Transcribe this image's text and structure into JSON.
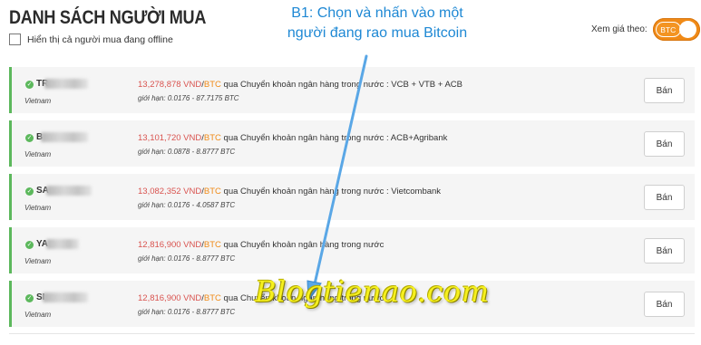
{
  "header": {
    "title": "DANH SÁCH NGƯỜI MUA",
    "offline_label": "Hiển thị cả người mua đang offline",
    "price_label": "Xem giá theo:",
    "currency_toggle": "BTC"
  },
  "instruction": {
    "line1": "B1: Chọn và nhấn vào một",
    "line2": "người đang rao mua Bitcoin"
  },
  "listings": [
    {
      "name": "TR",
      "country": "Vietnam",
      "price": "13,278,878 VND",
      "currency": "BTC",
      "method": " qua Chuyển khoản ngân hàng trong nước : VCB + VTB + ACB",
      "limit": "giới hạn: 0.0176 - 87.7175 BTC",
      "button": "Bán"
    },
    {
      "name": "B",
      "country": "Vietnam",
      "price": "13,101,720 VND",
      "currency": "BTC",
      "method": " qua Chuyển khoản ngân hàng trong nước : ACB+Agribank",
      "limit": "giới hạn: 0.0878 - 8.8777 BTC",
      "button": "Bán"
    },
    {
      "name": "SA",
      "country": "Vietnam",
      "price": "13,082,352 VND",
      "currency": "BTC",
      "method": " qua Chuyển khoản ngân hàng trong nước : Vietcombank",
      "limit": "giới hạn: 0.0176 - 4.0587 BTC",
      "button": "Bán"
    },
    {
      "name": "YA",
      "country": "Vietnam",
      "price": "12,816,900 VND",
      "currency": "BTC",
      "method": " qua Chuyển khoản ngân hàng trong nước",
      "limit": "giới hạn: 0.0176 - 8.8777 BTC",
      "button": "Bán"
    },
    {
      "name": "SI",
      "country": "Vietnam",
      "price": "12,816,900 VND",
      "currency": "BTC",
      "method": " qua Chuyển khoản ngân hàng trong nước",
      "limit": "giới hạn: 0.0176 - 8.8777 BTC",
      "button": "Bán"
    }
  ],
  "watermark": "Blogtienao.com",
  "colors": {
    "accent_orange": "#f08a17",
    "online_green": "#5cb85c",
    "price_red": "#d9534f",
    "annotation_blue": "#1e88d4",
    "watermark_yellow": "#f6f01e"
  },
  "icons": {
    "online_status": "check-circle-icon"
  }
}
